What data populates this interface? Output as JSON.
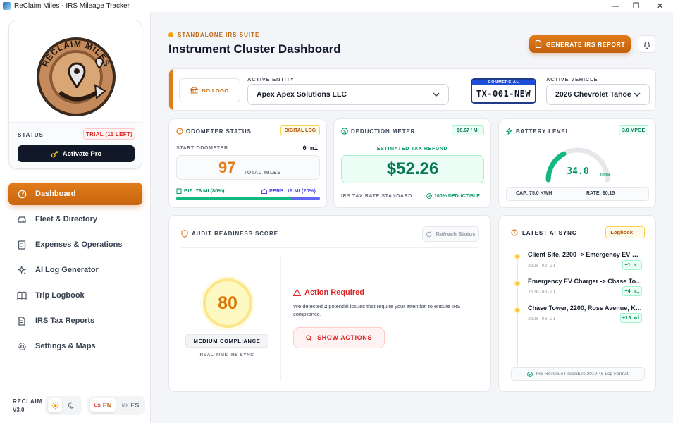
{
  "window": {
    "title": "ReClaim Miles - IRS Mileage Tracker",
    "controls": {
      "minimize": "—",
      "maximize": "❐",
      "close": "✕"
    }
  },
  "brand": {
    "logo_text": "RECLAIM MILES",
    "status_label": "STATUS",
    "trial_badge": "TRIAL (11 LEFT)",
    "activate_label": "Activate Pro"
  },
  "nav": {
    "items": [
      {
        "label": "Dashboard",
        "icon": "gauge-icon"
      },
      {
        "label": "Fleet & Directory",
        "icon": "car-icon"
      },
      {
        "label": "Expenses & Operations",
        "icon": "receipt-icon"
      },
      {
        "label": "AI Log Generator",
        "icon": "sparkle-icon"
      },
      {
        "label": "Trip Logbook",
        "icon": "book-icon"
      },
      {
        "label": "IRS Tax Reports",
        "icon": "document-icon"
      },
      {
        "label": "Settings & Maps",
        "icon": "gear-icon"
      }
    ],
    "active_index": 0
  },
  "footer": {
    "app_name": "RECLAIM",
    "version": "V3.0",
    "lang_us_flag": "US",
    "lang_en": "EN",
    "lang_mx_flag": "MX",
    "lang_es": "ES"
  },
  "header": {
    "eyebrow": "STANDALONE IRS SUITE",
    "title": "Instrument Cluster Dashboard",
    "generate_label": "GENERATE IRS REPORT"
  },
  "entity": {
    "no_logo": "NO LOGO",
    "entity_label": "ACTIVE ENTITY",
    "entity_value": "Apex Apex Solutions LLC",
    "plate_type": "COMMERCIAL",
    "plate_number": "TX-001-NEW",
    "vehicle_label": "ACTIVE VEHICLE",
    "vehicle_value": "2026 Chevrolet Tahoe"
  },
  "odometer": {
    "title": "ODOMETER STATUS",
    "tag": "DIGITAL LOG",
    "start_label": "START ODOMETER",
    "start_value": "0 mi",
    "total_value": "97",
    "total_label": "TOTAL MILES",
    "biz_label": "BIZ: 78 MI (80%)",
    "pers_label": "PERS: 19 MI (20%)",
    "biz_fraction": 0.8,
    "colors": {
      "biz": "#10b981",
      "pers": "#6366f1"
    }
  },
  "deduction": {
    "title": "DEDUCTION METER",
    "tag": "$0.67 / MI",
    "refund_label": "ESTIMATED TAX REFUND",
    "refund_value": "$52.26",
    "rate_label": "IRS TAX RATE STANDARD",
    "deductible_label": "100% DEDUCTIBLE"
  },
  "battery": {
    "title": "BATTERY LEVEL",
    "tag": "3.0 MPGE",
    "level_value": "34.0",
    "level_max_label": "100%",
    "level_fraction": 0.34,
    "cap_label": "CAP: 75.0 KWH",
    "rate_label": "RATE: $0.15",
    "color": "#10b981"
  },
  "audit": {
    "title": "AUDIT READINESS SCORE",
    "refresh_label": "Refresh Status",
    "score": "80",
    "compliance_label": "MEDIUM COMPLIANCE",
    "sync_label": "REAL-TIME IRS SYNC",
    "action_title": "Action Required",
    "action_text_before": "We detected ",
    "action_count": "2",
    "action_text_after": " potential issues that require your attention to ensure IRS compliance.",
    "show_actions_label": "SHOW ACTIONS"
  },
  "sync": {
    "title": "LATEST AI SYNC",
    "logbook_label": "Logbook →",
    "items": [
      {
        "title": "Client Site, 2200 -> Emergency EV Ch...",
        "date": "2026-08-21",
        "miles": "+1 mi"
      },
      {
        "title": "Emergency EV Charger -> Chase Tow...",
        "date": "2026-08-21",
        "miles": "+4 mi"
      },
      {
        "title": "Chase Tower, 2200, Ross Avenue, Kly...",
        "date": "2026-08-21",
        "miles": "+15 mi"
      }
    ],
    "footer_label": "IRS Revenue Procedure 2019-46 Log Format"
  }
}
